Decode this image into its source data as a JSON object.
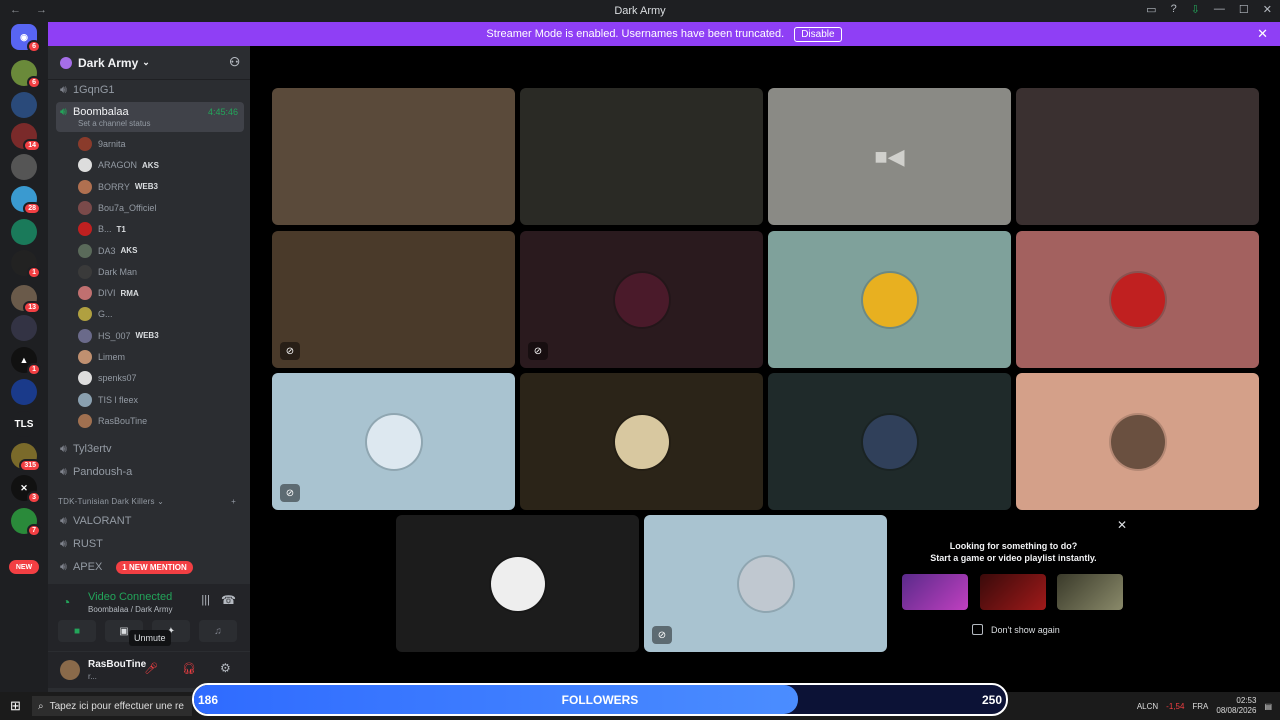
{
  "window": {
    "title": "Dark Army",
    "nav": "← →"
  },
  "banner": {
    "text": "Streamer Mode is enabled. Usernames have been truncated.",
    "button": "Disable"
  },
  "server": {
    "name": "Dark Army"
  },
  "guild_badges": [
    "6",
    "6",
    "",
    "14",
    "",
    "28",
    "",
    "1",
    "13",
    "",
    "1",
    "",
    "",
    "315",
    "3",
    "7",
    "NEW"
  ],
  "guild_tls": "TLS",
  "channels": [
    {
      "name": "1GqnG1"
    },
    {
      "name": "Boombalaa",
      "timer": "4:45:46",
      "status": "Set a channel status"
    }
  ],
  "members": [
    {
      "name": "9arnita",
      "tag": "",
      "color": "#8a3b2b"
    },
    {
      "name": "ARAGON",
      "tag": "AKS",
      "color": "#ddd"
    },
    {
      "name": "BORRY",
      "tag": "WEB3",
      "color": "#b07050"
    },
    {
      "name": "Bou7a_Officiel",
      "tag": "",
      "color": "#7a4a4a"
    },
    {
      "name": "B...",
      "tag": "T1",
      "color": "#c02020"
    },
    {
      "name": "DA3",
      "tag": "AKS",
      "color": "#5a6a5a"
    },
    {
      "name": "Dark Man",
      "tag": "",
      "color": "#3a3a3a"
    },
    {
      "name": "DIVI",
      "tag": "RMA",
      "color": "#c07070"
    },
    {
      "name": "G...",
      "tag": "",
      "color": "#b0a040"
    },
    {
      "name": "HS_007",
      "tag": "WEB3",
      "color": "#6a6a8a"
    },
    {
      "name": "Limem",
      "tag": "",
      "color": "#c09070"
    },
    {
      "name": "spenks07",
      "tag": "",
      "color": "#ddd"
    },
    {
      "name": "TIS l fleex",
      "tag": "",
      "color": "#8aa0b0"
    },
    {
      "name": "RasBouTine",
      "tag": "",
      "color": "#a07050"
    }
  ],
  "more_channels": [
    "Tyl3ertv",
    "Pandoush-a"
  ],
  "category": "TDK-Tunisian Dark Killers",
  "cat_channels": [
    "VALORANT",
    "RUST",
    "APEX"
  ],
  "mention": "1 NEW MENTION",
  "voice": {
    "status": "Video Connected",
    "location": "Boombalaa / Dark Army"
  },
  "user": {
    "name": "RasBouTine",
    "sub": "r..."
  },
  "tooltip": "Unmute",
  "suggest": {
    "line1": "Looking for something to do?",
    "line2": "Start a game or video playlist instantly.",
    "checkbox": "Don't show again"
  },
  "taskbar": {
    "search": "Tapez ici pour effectuer une re",
    "ticker": "ALCN",
    "change": "-1,54",
    "lang": "FRA",
    "time": "02:53",
    "date": "08/08/2026"
  },
  "followers": {
    "label": "FOLLOWERS",
    "current": "186",
    "goal": "250",
    "progress": 0.744
  },
  "colors": {
    "accent": "#8f3ff5",
    "green": "#23a55a",
    "red": "#f23f43"
  }
}
